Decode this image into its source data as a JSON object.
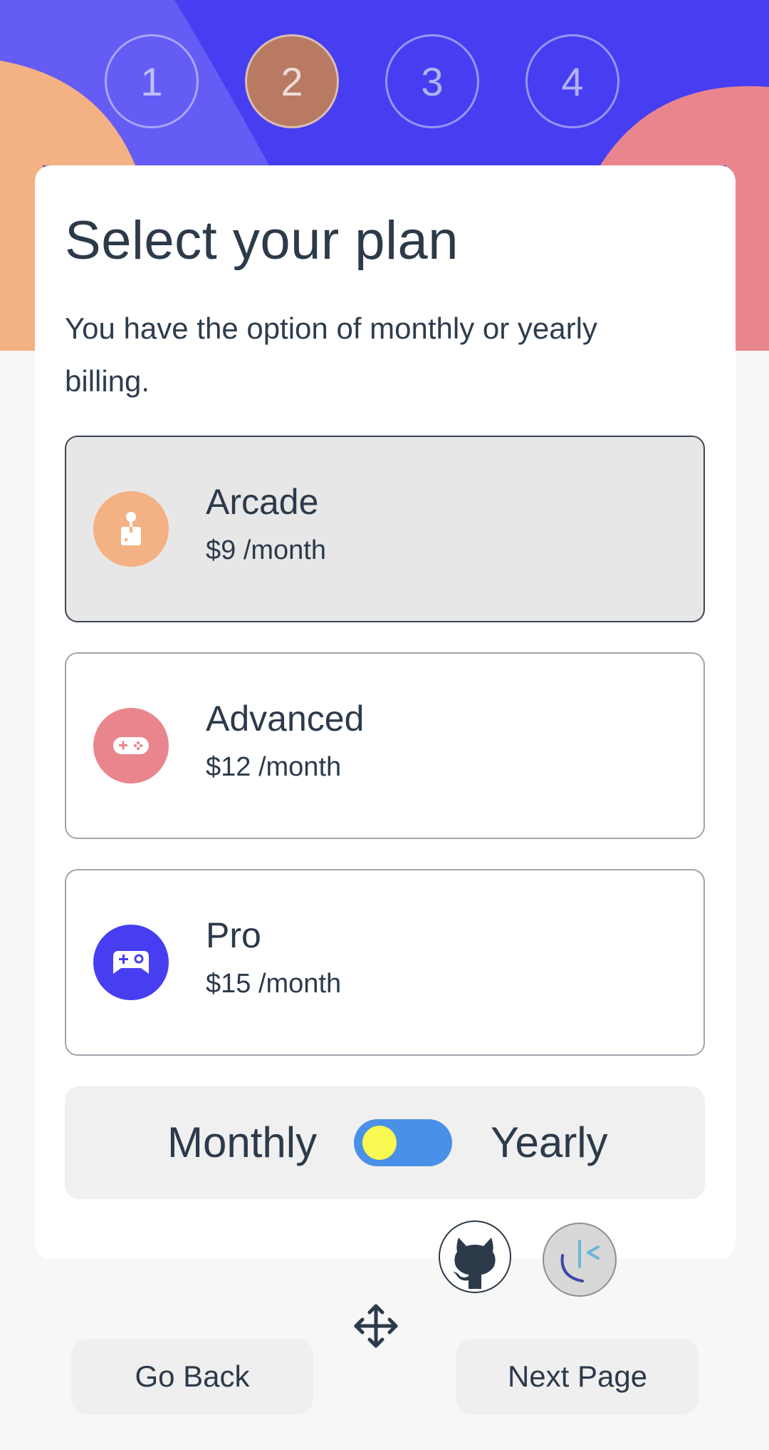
{
  "steps": [
    {
      "label": "1",
      "active": false
    },
    {
      "label": "2",
      "active": true
    },
    {
      "label": "3",
      "active": false
    },
    {
      "label": "4",
      "active": false
    }
  ],
  "header": {
    "title": "Select your plan",
    "subtitle": "You have the option of monthly or yearly billing."
  },
  "plans": [
    {
      "name": "Arcade",
      "price": "$9 /month",
      "icon": "joystick-icon",
      "color": "#f4b183",
      "selected": true
    },
    {
      "name": "Advanced",
      "price": "$12 /month",
      "icon": "gamepad-icon",
      "color": "#e9868d",
      "selected": false
    },
    {
      "name": "Pro",
      "price": "$15 /month",
      "icon": "controller-icon",
      "color": "#473ef2",
      "selected": false
    }
  ],
  "billing": {
    "monthly_label": "Monthly",
    "yearly_label": "Yearly",
    "toggle_state": "monthly"
  },
  "extras": {
    "github_icon": "github-icon",
    "clickhouse_icon": "clock-logo-icon",
    "move_icon": "move-icon"
  },
  "footer": {
    "back_label": "Go Back",
    "next_label": "Next Page"
  },
  "colors": {
    "accent": "#473ef2",
    "peach": "#f4b183",
    "pink": "#e9868d",
    "toggle": "#4a90e8",
    "knob": "#f8f850"
  }
}
